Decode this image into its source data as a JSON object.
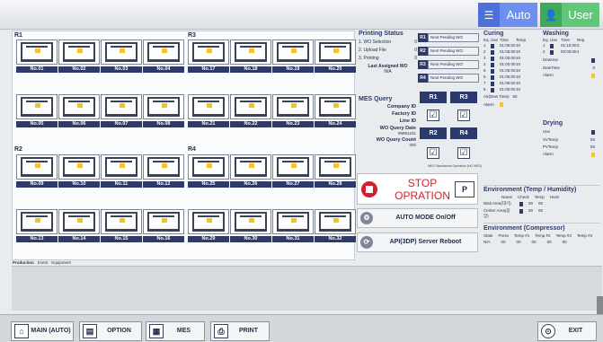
{
  "header": {
    "auto_label": "Auto",
    "user_label": "User"
  },
  "groups": {
    "r1": "R1",
    "r2": "R2",
    "r3": "R3",
    "r4": "R4"
  },
  "printers": [
    "No.01",
    "No.02",
    "No.03",
    "No.04",
    "No.17",
    "No.18",
    "No.19",
    "No.20",
    "No.05",
    "No.06",
    "No.07",
    "No.08",
    "No.21",
    "No.22",
    "No.23",
    "No.24",
    "No.09",
    "No.10",
    "No.11",
    "No.12",
    "No.25",
    "No.26",
    "No.27",
    "No.28",
    "No.13",
    "No.14",
    "No.15",
    "No.16",
    "No.29",
    "No.30",
    "No.31",
    "No.32"
  ],
  "tabs": [
    "Production",
    "Event",
    "Equipment"
  ],
  "printing_status": {
    "title": "Printing Status",
    "rows": [
      [
        "1. WO Selection",
        "0"
      ],
      [
        "2. Upload File",
        "0"
      ],
      [
        "3. Printing",
        "0"
      ]
    ],
    "last_wo_label": "Last Assigned WO",
    "last_wo_value": "N/A"
  },
  "pending": [
    {
      "tag": "R1",
      "text": "Next Pending WO"
    },
    {
      "tag": "R2",
      "text": "Next Pending WO"
    },
    {
      "tag": "R3",
      "text": "Next Pending WO"
    },
    {
      "tag": "R4",
      "text": "Next Pending WO"
    }
  ],
  "mes": {
    "title": "MES Query",
    "company": "Company ID",
    "factory": "Factory ID",
    "line": "Line ID",
    "date_label": "WO Query Date",
    "date_value": "99991231",
    "count_label": "WO Query Count",
    "count_value": "000"
  },
  "select": {
    "r1": "R1",
    "r3": "R3",
    "r2": "R2",
    "r4": "R4",
    "check": "☑",
    "standalone": "MES Standalone Operation (NO MES)"
  },
  "stop": {
    "label": "STOP OPRATION",
    "mode": "P"
  },
  "auto_mode": "AUTO MODE On/Off",
  "api_reboot": "API(3DP) Server Reboot",
  "curing": {
    "title": "Curing",
    "headers": [
      "Eq.",
      "Use",
      "Time",
      "Temp"
    ],
    "rows": [
      [
        "1",
        "01:05:00",
        "10"
      ],
      [
        "2",
        "01:05:00",
        "10"
      ],
      [
        "3",
        "01:05:00",
        "10"
      ],
      [
        "4",
        "01:05:00",
        "10"
      ],
      [
        "5",
        "01:05:00",
        "10"
      ],
      [
        "6",
        "01:05:00",
        "10"
      ],
      [
        "7",
        "01:05:00",
        "10"
      ],
      [
        "8",
        "01:05:00",
        "10"
      ]
    ],
    "air_label": "Air(Dew Time)",
    "air_value": "50",
    "alarm_label": "Alarm"
  },
  "washing": {
    "title": "Washing",
    "headers": [
      "Eq.",
      "Use",
      "Time",
      "Rep."
    ],
    "rows": [
      [
        "1",
        "01:10:00",
        "3"
      ],
      [
        "2",
        "00:00:00",
        "4"
      ]
    ],
    "dew_use": "DewUse",
    "dew_time": "DewTime",
    "dew_time_val": "0",
    "alarm_label": "Alarm"
  },
  "drying": {
    "title": "Drying",
    "use": "Use",
    "sv": "SVTemp",
    "sv_val": "50",
    "pv": "PVTemp",
    "pv_val": "50",
    "alarm": "Alarm"
  },
  "env1": {
    "title": "Environment (Temp / Humidity)",
    "headers": [
      "Name",
      "Check",
      "Temp",
      "Humi"
    ],
    "rows": [
      [
        "Wait Area(대기)",
        "00",
        "00"
      ],
      [
        "Center Area(중앙)",
        "00",
        "00"
      ]
    ]
  },
  "env2": {
    "title": "Environment (Compressor)",
    "headers": [
      "State",
      "Press",
      "Temp #1",
      "Temp #2",
      "Temp #3",
      "Temp #4"
    ],
    "values": [
      "N/A",
      "00",
      "00",
      "00",
      "00",
      "00"
    ]
  },
  "bottom": {
    "main": "MAIN (AUTO)",
    "option": "OPTION",
    "mes": "MES",
    "print": "PRINT",
    "exit": "EXIT"
  }
}
